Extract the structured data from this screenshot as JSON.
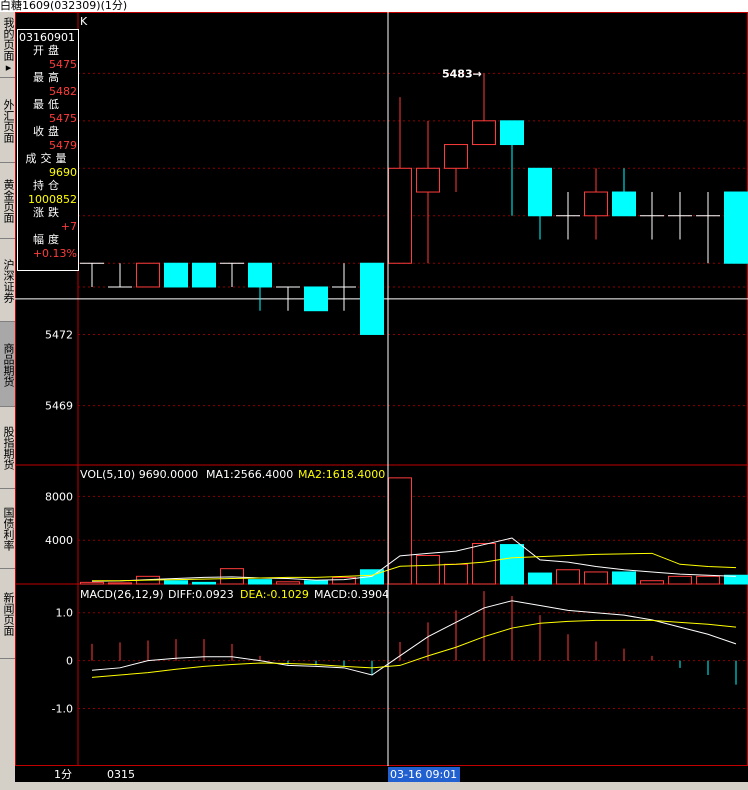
{
  "window": {
    "title": "白糖1609(032309)(1分)"
  },
  "tabs": [
    {
      "label": "我的页面"
    },
    {
      "label": "外汇页面"
    },
    {
      "label": "黄金页面"
    },
    {
      "label": "沪深证券"
    },
    {
      "label": "商品期货"
    },
    {
      "label": "股指期货"
    },
    {
      "label": "国债利率"
    },
    {
      "label": "新闻页面"
    }
  ],
  "info_panel": {
    "time": "03160901",
    "rows": [
      {
        "label": "开盘",
        "value": "5475",
        "color": "#ff3c3c"
      },
      {
        "label": "最高",
        "value": "5482",
        "color": "#ff3c3c"
      },
      {
        "label": "最低",
        "value": "5475",
        "color": "#ff3c3c"
      },
      {
        "label": "收盘",
        "value": "5479",
        "color": "#ff3c3c"
      },
      {
        "label": "成交量",
        "value": "9690",
        "color": "#ffff00"
      },
      {
        "label": "持仓",
        "value": "1000852",
        "color": "#ffff00"
      },
      {
        "label": "涨跌",
        "value": "+7",
        "color": "#ff3c3c"
      },
      {
        "label": "幅度",
        "value": "+0.13%",
        "color": "#ff3c3c"
      }
    ]
  },
  "chart_data": [
    {
      "type": "candlestick",
      "panel_label": "K",
      "y_ticks": [
        "5472",
        "5469"
      ],
      "y_tick_values": [
        5472,
        5469
      ],
      "max_annotation": "5483",
      "max_value": 5483,
      "ohlc": [
        [
          5475,
          5475,
          5474,
          5475
        ],
        [
          5474,
          5475,
          5474,
          5474
        ],
        [
          5474,
          5475,
          5474,
          5475
        ],
        [
          5475,
          5475,
          5474,
          5474
        ],
        [
          5475,
          5475,
          5474,
          5474
        ],
        [
          5475,
          5475,
          5474,
          5475
        ],
        [
          5475,
          5475,
          5473,
          5474
        ],
        [
          5474,
          5474,
          5473,
          5474
        ],
        [
          5474,
          5474,
          5473,
          5473
        ],
        [
          5474,
          5475,
          5473,
          5474
        ],
        [
          5475,
          5475,
          5472,
          5472
        ],
        [
          5475,
          5482,
          5475,
          5479
        ],
        [
          5478,
          5481,
          5475,
          5479
        ],
        [
          5479,
          5480,
          5478,
          5480
        ],
        [
          5480,
          5483,
          5480,
          5481
        ],
        [
          5481,
          5481,
          5477,
          5480
        ],
        [
          5479,
          5479,
          5476,
          5477
        ],
        [
          5477,
          5478,
          5476,
          5477
        ],
        [
          5477,
          5479,
          5476,
          5478
        ],
        [
          5478,
          5479,
          5477,
          5477
        ],
        [
          5477,
          5478,
          5476,
          5477
        ],
        [
          5477,
          5478,
          5476,
          5477
        ],
        [
          5477,
          5478,
          5475,
          5477
        ],
        [
          5478,
          5478,
          5475,
          5475
        ]
      ]
    },
    {
      "type": "bar",
      "title": "VOL(5,10)",
      "title_value": "9690.0000",
      "ma1_label": "MA1:2566.4000",
      "ma2_label": "MA2:1618.4000",
      "y_ticks": [
        "8000",
        "4000"
      ],
      "y_tick_values": [
        8000,
        4000
      ],
      "volume": [
        150,
        100,
        700,
        300,
        150,
        1400,
        400,
        200,
        300,
        600,
        1300,
        9690,
        2600,
        1800,
        3700,
        3600,
        1000,
        1300,
        1100,
        1100,
        300,
        700,
        700,
        800
      ],
      "ma1": [
        250,
        280,
        400,
        500,
        600,
        650,
        550,
        500,
        350,
        400,
        700,
        2566,
        2800,
        3000,
        3600,
        4200,
        2200,
        2000,
        1600,
        1300,
        1100,
        900,
        800,
        700
      ],
      "ma2": [
        300,
        300,
        350,
        400,
        450,
        500,
        550,
        600,
        600,
        700,
        800,
        1618,
        1700,
        1800,
        2000,
        2400,
        2500,
        2600,
        2700,
        2750,
        2800,
        1800,
        1600,
        1500
      ]
    },
    {
      "type": "line",
      "title": "MACD(26,12,9)",
      "diff_label": "DIFF:0.0923",
      "dea_label": "DEA:-0.1029",
      "macd_label": "MACD:0.3904",
      "y_ticks": [
        "1.0",
        "0",
        "-1.0"
      ],
      "y_tick_values": [
        1.0,
        0,
        -1.0
      ],
      "diff": [
        -0.2,
        -0.15,
        0.0,
        0.05,
        0.08,
        0.08,
        0.0,
        -0.1,
        -0.12,
        -0.15,
        -0.3,
        0.1,
        0.5,
        0.8,
        1.1,
        1.25,
        1.15,
        1.05,
        1.0,
        0.95,
        0.85,
        0.7,
        0.55,
        0.35
      ],
      "dea": [
        -0.35,
        -0.3,
        -0.25,
        -0.18,
        -0.12,
        -0.08,
        -0.05,
        -0.06,
        -0.08,
        -0.12,
        -0.15,
        -0.1,
        0.1,
        0.28,
        0.5,
        0.68,
        0.78,
        0.82,
        0.84,
        0.84,
        0.84,
        0.8,
        0.76,
        0.7
      ],
      "macd": [
        0.35,
        0.38,
        0.42,
        0.45,
        0.45,
        0.35,
        0.1,
        -0.08,
        -0.1,
        -0.12,
        -0.3,
        0.39,
        0.8,
        1.05,
        1.45,
        1.35,
        0.95,
        0.55,
        0.4,
        0.25,
        0.1,
        -0.15,
        -0.3,
        -0.5
      ]
    }
  ],
  "x_axis": {
    "period_label": "1分",
    "date_label": "0315",
    "cursor_label": "03-16 09:01",
    "cursor_index": 11
  },
  "colors": {
    "up": "#ff3c3c",
    "down": "#00ffff",
    "grid": "#8b0000",
    "axis_text": "#ffffff",
    "ma2": "#ffff00",
    "cursor_label_bg": "#2060d0"
  }
}
